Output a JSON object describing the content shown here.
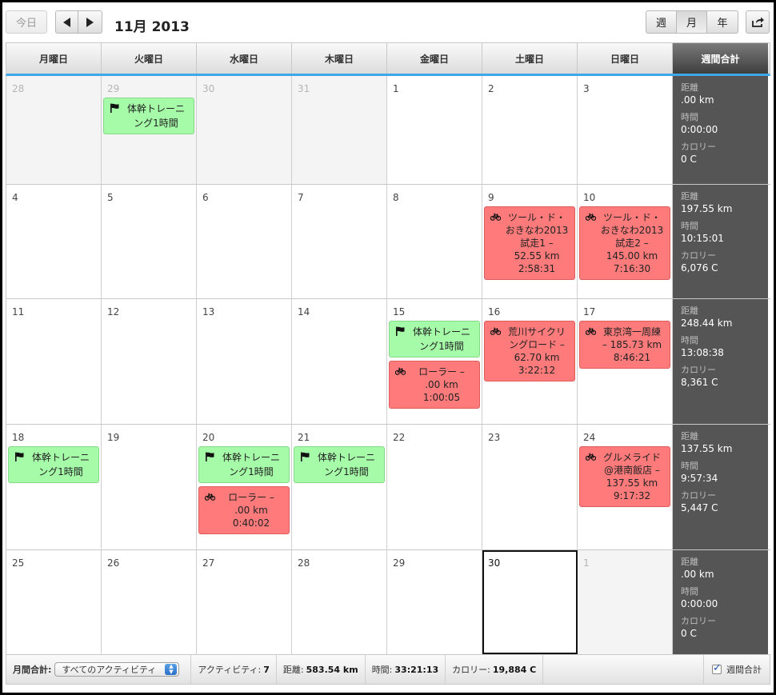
{
  "toolbar": {
    "today_label": "今日",
    "title": "11月 2013",
    "view_week": "週",
    "view_month": "月",
    "view_year": "年"
  },
  "header": {
    "days": [
      "月曜日",
      "火曜日",
      "水曜日",
      "木曜日",
      "金曜日",
      "土曜日",
      "日曜日"
    ],
    "weekly_total": "週間合計"
  },
  "summary_labels": {
    "distance": "距離",
    "time": "時間",
    "calories": "カロリー"
  },
  "colors": {
    "accent_blue": "#3fa6e8",
    "event_green": "#a5fba8",
    "event_red": "#ff7b7b",
    "weekly_bg": "#555555"
  },
  "weeks": [
    {
      "days": [
        {
          "num": "28",
          "other": true,
          "events": []
        },
        {
          "num": "29",
          "other": true,
          "events": [
            {
              "type": "green",
              "icon": "flag-icon",
              "lines": [
                "体幹トレーニ",
                "ング1時間"
              ]
            }
          ]
        },
        {
          "num": "30",
          "other": true,
          "events": []
        },
        {
          "num": "31",
          "other": true,
          "events": []
        },
        {
          "num": "1",
          "events": []
        },
        {
          "num": "2",
          "events": []
        },
        {
          "num": "3",
          "events": []
        }
      ],
      "summary": {
        "distance": ".00 km",
        "time": "0:00:00",
        "calories": "0 C"
      }
    },
    {
      "days": [
        {
          "num": "4",
          "events": []
        },
        {
          "num": "5",
          "events": []
        },
        {
          "num": "6",
          "events": []
        },
        {
          "num": "7",
          "events": []
        },
        {
          "num": "8",
          "events": []
        },
        {
          "num": "9",
          "events": [
            {
              "type": "red",
              "icon": "bicycle-icon",
              "lines": [
                "ツール・ド・",
                "おきなわ2013",
                "試走1 –",
                "52.55 km",
                "2:58:31"
              ]
            }
          ]
        },
        {
          "num": "10",
          "events": [
            {
              "type": "red",
              "icon": "bicycle-icon",
              "lines": [
                "ツール・ド・",
                "おきなわ2013",
                "試走2 –",
                "145.00 km",
                "7:16:30"
              ]
            }
          ]
        }
      ],
      "summary": {
        "distance": "197.55 km",
        "time": "10:15:01",
        "calories": "6,076 C"
      }
    },
    {
      "days": [
        {
          "num": "11",
          "events": []
        },
        {
          "num": "12",
          "events": []
        },
        {
          "num": "13",
          "events": []
        },
        {
          "num": "14",
          "events": []
        },
        {
          "num": "15",
          "events": [
            {
              "type": "green",
              "icon": "flag-icon",
              "lines": [
                "体幹トレーニ",
                "ング1時間"
              ]
            },
            {
              "type": "red",
              "icon": "bicycle-icon",
              "lines": [
                "ローラー –",
                ".00 km",
                "1:00:05"
              ]
            }
          ]
        },
        {
          "num": "16",
          "events": [
            {
              "type": "red",
              "icon": "bicycle-icon",
              "lines": [
                "荒川サイクリ",
                "ングロード –",
                "62.70 km",
                "3:22:12"
              ]
            }
          ]
        },
        {
          "num": "17",
          "events": [
            {
              "type": "red",
              "icon": "bicycle-icon",
              "lines": [
                "東京湾一周練",
                "– 185.73 km",
                "8:46:21"
              ]
            }
          ]
        }
      ],
      "summary": {
        "distance": "248.44 km",
        "time": "13:08:38",
        "calories": "8,361 C"
      }
    },
    {
      "days": [
        {
          "num": "18",
          "events": [
            {
              "type": "green",
              "icon": "flag-icon",
              "lines": [
                "体幹トレーニ",
                "ング1時間"
              ]
            }
          ]
        },
        {
          "num": "19",
          "events": []
        },
        {
          "num": "20",
          "events": [
            {
              "type": "green",
              "icon": "flag-icon",
              "lines": [
                "体幹トレーニ",
                "ング1時間"
              ]
            },
            {
              "type": "red",
              "icon": "bicycle-icon",
              "lines": [
                "ローラー –",
                ".00 km",
                "0:40:02"
              ]
            }
          ]
        },
        {
          "num": "21",
          "events": [
            {
              "type": "green",
              "icon": "flag-icon",
              "lines": [
                "体幹トレーニ",
                "ング1時間"
              ]
            }
          ]
        },
        {
          "num": "22",
          "events": []
        },
        {
          "num": "23",
          "events": []
        },
        {
          "num": "24",
          "events": [
            {
              "type": "red",
              "icon": "bicycle-icon",
              "lines": [
                "グルメライド",
                "@港南飯店 –",
                "137.55 km",
                "9:17:32"
              ]
            }
          ]
        }
      ],
      "summary": {
        "distance": "137.55 km",
        "time": "9:57:34",
        "calories": "5,447 C"
      }
    },
    {
      "days": [
        {
          "num": "25",
          "events": []
        },
        {
          "num": "26",
          "events": []
        },
        {
          "num": "27",
          "events": []
        },
        {
          "num": "28",
          "events": []
        },
        {
          "num": "29",
          "events": []
        },
        {
          "num": "30",
          "today": true,
          "events": []
        },
        {
          "num": "1",
          "other": true,
          "events": []
        }
      ],
      "summary": {
        "distance": ".00 km",
        "time": "0:00:00",
        "calories": "0 C"
      }
    }
  ],
  "footer": {
    "label": "月間合計:",
    "filter": "すべてのアクティビティ",
    "activities_label": "アクティビティ:",
    "activities": "7",
    "distance_label": "距離:",
    "distance": "583.54 km",
    "time_label": "時間:",
    "time": "33:21:13",
    "calories_label": "カロリー:",
    "calories": "19,884 C",
    "weekly_toggle": "週間合計"
  }
}
